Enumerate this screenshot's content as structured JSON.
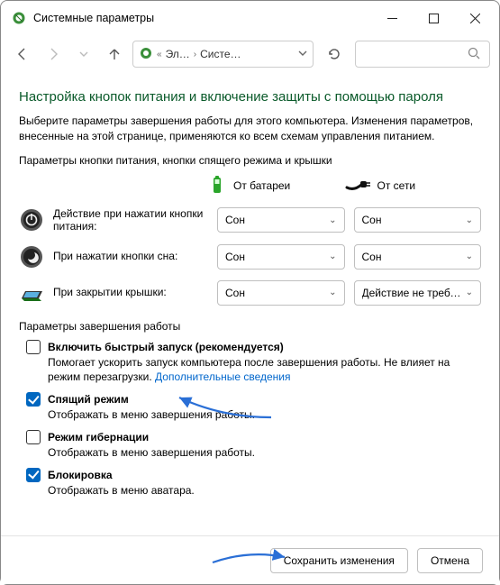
{
  "window": {
    "title": "Системные параметры"
  },
  "nav": {
    "crumb1": "Эл…",
    "crumb2": "Систе…"
  },
  "page": {
    "title": "Настройка кнопок питания и включение защиты с помощью пароля",
    "desc": "Выберите параметры завершения работы для этого компьютера. Изменения параметров, внесенные на этой странице, применяются ко всем схемам управления питанием.",
    "power_section_label": "Параметры кнопки питания, кнопки спящего режима и крышки",
    "col_battery": "От батареи",
    "col_ac": "От сети",
    "rows": [
      {
        "label": "Действие при нажатии кнопки питания:",
        "battery": "Сон",
        "ac": "Сон"
      },
      {
        "label": "При нажатии кнопки сна:",
        "battery": "Сон",
        "ac": "Сон"
      },
      {
        "label": "При закрытии крышки:",
        "battery": "Сон",
        "ac": "Действие не требуется"
      }
    ],
    "shutdown_section_label": "Параметры завершения работы",
    "shutdown_items": [
      {
        "checked": false,
        "title": "Включить быстрый запуск (рекомендуется)",
        "sub": "Помогает ускорить запуск компьютера после завершения работы. Не влияет на режим перезагрузки.",
        "link": "Дополнительные сведения"
      },
      {
        "checked": true,
        "title": "Спящий режим",
        "sub": "Отображать в меню завершения работы."
      },
      {
        "checked": false,
        "title": "Режим гибернации",
        "sub": "Отображать в меню завершения работы."
      },
      {
        "checked": true,
        "title": "Блокировка",
        "sub": "Отображать в меню аватара."
      }
    ]
  },
  "footer": {
    "save": "Сохранить изменения",
    "cancel": "Отмена"
  }
}
